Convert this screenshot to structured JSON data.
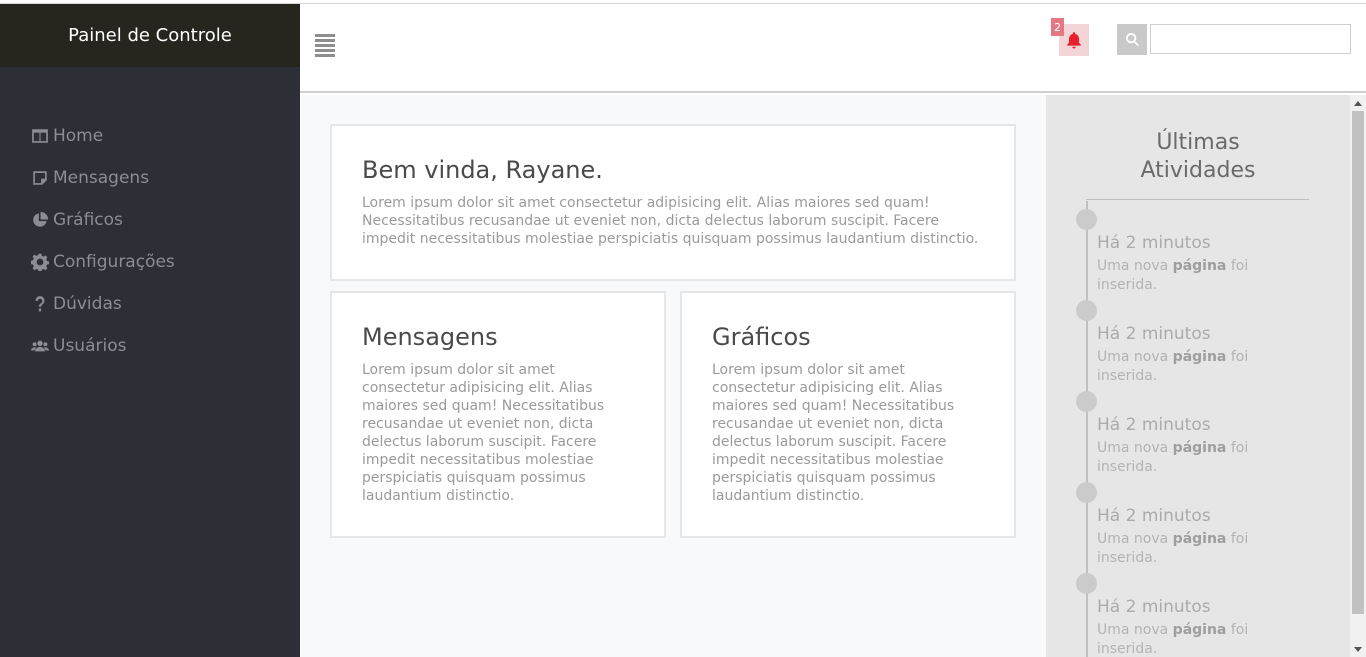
{
  "sidebar": {
    "brand": "Painel de Controle",
    "items": [
      {
        "label": "Home",
        "icon": "columns-icon"
      },
      {
        "label": "Mensagens",
        "icon": "note-icon"
      },
      {
        "label": "Gráficos",
        "icon": "pie-chart-icon"
      },
      {
        "label": "Configurações",
        "icon": "gear-icon"
      },
      {
        "label": "Dúvidas",
        "icon": "question-icon"
      },
      {
        "label": "Usuários",
        "icon": "users-icon"
      }
    ]
  },
  "header": {
    "notification_count": "2",
    "search_value": "",
    "accent_color": "#e8202b"
  },
  "main": {
    "welcome": {
      "title": "Bem vinda, Rayane.",
      "text": "Lorem ipsum dolor sit amet consectetur adipisicing elit. Alias maiores sed quam! Necessitatibus recusandae ut eveniet non, dicta delectus laborum suscipit. Facere impedit necessitatibus molestiae perspiciatis quisquam possimus laudantium distinctio."
    },
    "messages": {
      "title": "Mensagens",
      "text": "Lorem ipsum dolor sit amet consectetur adipisicing elit. Alias maiores sed quam! Necessitatibus recusandae ut eveniet non, dicta delectus laborum suscipit. Facere impedit necessitatibus molestiae perspiciatis quisquam possimus laudantium distinctio."
    },
    "charts": {
      "title": "Gráficos",
      "text": "Lorem ipsum dolor sit amet consectetur adipisicing elit. Alias maiores sed quam! Necessitatibus recusandae ut eveniet non, dicta delectus laborum suscipit. Facere impedit necessitatibus molestiae perspiciatis quisquam possimus laudantium distinctio."
    }
  },
  "activities": {
    "title_line1": "Últimas",
    "title_line2": "Atividades",
    "items": [
      {
        "time": "Há 2 minutos",
        "text_pre": "Uma nova",
        "text_bold": "página",
        "text_post": "foi inserida."
      },
      {
        "time": "Há 2 minutos",
        "text_pre": "Uma nova",
        "text_bold": "página",
        "text_post": "foi inserida."
      },
      {
        "time": "Há 2 minutos",
        "text_pre": "Uma nova",
        "text_bold": "página",
        "text_post": "foi inserida."
      },
      {
        "time": "Há 2 minutos",
        "text_pre": "Uma nova",
        "text_bold": "página",
        "text_post": "foi inserida."
      },
      {
        "time": "Há 2 minutos",
        "text_pre": "Uma nova",
        "text_bold": "página",
        "text_post": "foi inserida."
      }
    ]
  }
}
